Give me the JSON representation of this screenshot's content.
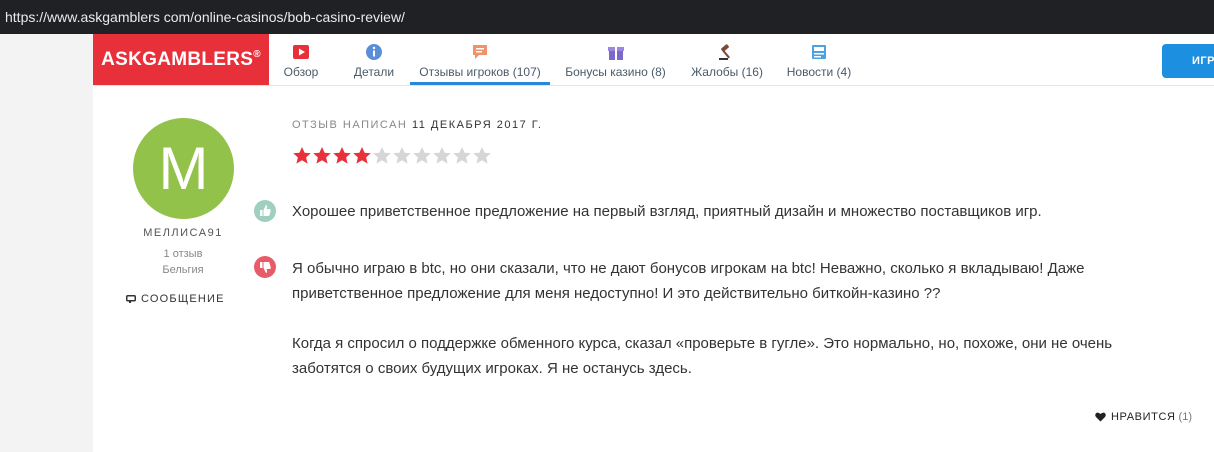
{
  "browser": {
    "url": "https://www.askgamblers com/online-casinos/bob-casino-review/"
  },
  "brand": {
    "logo_text": "ASKGAMBLERS",
    "logo_mark": "®",
    "color": "#e8303a"
  },
  "nav": {
    "tabs": [
      {
        "label": "Обзор",
        "icon": "play-icon"
      },
      {
        "label": "Детали",
        "icon": "info-icon"
      },
      {
        "label": "Отзывы игроков (107)",
        "icon": "comment-icon",
        "active": true
      },
      {
        "label": "Бонусы казино (8)",
        "icon": "gift-icon"
      },
      {
        "label": "Жалобы (16)",
        "icon": "gavel-icon"
      },
      {
        "label": "Новости (4)",
        "icon": "news-icon"
      }
    ],
    "cta_label": "ИГР"
  },
  "user": {
    "initial": "M",
    "name": "МЕЛЛИСА91",
    "reviews": "1 отзыв",
    "country": "Бельгия",
    "message_label": "СООБЩЕНИЕ",
    "avatar_color": "#93c24a"
  },
  "review": {
    "date_prefix": "ОТЗЫВ НАПИСАН",
    "date": "11 ДЕКАБРЯ 2017 Г.",
    "rating": 4,
    "max_rating": 10,
    "pro_text": "Хорошее приветственное предложение на первый взгляд, приятный дизайн и множество поставщиков игр.",
    "con_text_1": "Я обычно играю в btc, но они сказали, что не дают бонусов игрокам на btc! Неважно, сколько я вкладываю! Даже приветственное предложение для меня недоступно! И это действительно биткойн-казино ??",
    "con_text_2": "Когда я спросил о поддержке обменного курса, сказал «проверьте в гугле». Это нормально, но, похоже, они не очень заботятся о своих будущих игроках. Я не останусь здесь.",
    "like_label": "НРАВИТСЯ",
    "like_count": "(1)"
  },
  "colors": {
    "star_on": "#e8303a",
    "star_off": "#d6d6d6",
    "accent": "#2b88d8"
  }
}
